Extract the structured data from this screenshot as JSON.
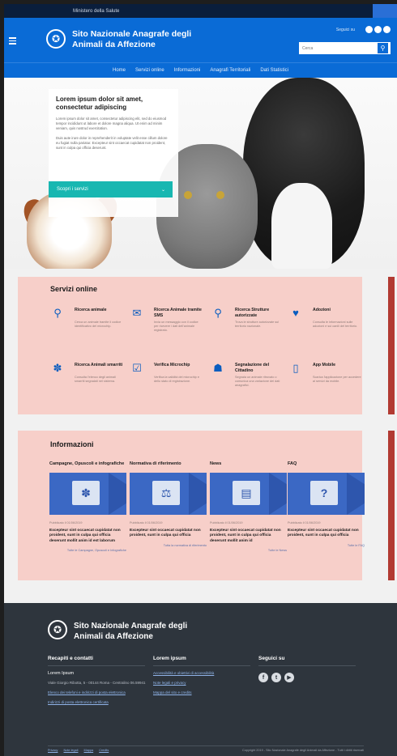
{
  "topbar": {
    "text": "Ministero della Salute"
  },
  "header": {
    "title_line1": "Sito Nazionale Anagrafe degli",
    "title_line2": "Animali da Affezione",
    "login": "Seguici su",
    "search_placeholder": "Cerca",
    "colors": {
      "primary": "#0a6bd6",
      "accent": "#18b7b1"
    }
  },
  "nav": {
    "items": [
      "Home",
      "Servizi online",
      "Informazioni",
      "Anagrafi Territoriali",
      "Dati Statistici"
    ]
  },
  "hero": {
    "title": "Lorem ipsum dolor sit amet, consectetur adipiscing",
    "para1": "Lorem ipsum dolor sit amet, consectetur adipiscing elit, sed do eiusmod tempor incididunt ut labore et dolore magna aliqua. Ut enim ad minim veniam, quis nostrud exercitation.",
    "para2": "Duis aute irure dolor in reprehenderit in voluptate velit esse cillum dolore eu fugiat nulla pariatur. Excepteur sint occaecat cupidatat non proident, sunt in culpa qui officia deserunt.",
    "cta": "Scopri i servizi"
  },
  "services": {
    "title": "Servizi online",
    "items": [
      {
        "icon": "search-icon",
        "glyph": "🔍",
        "title": "Ricerca animale",
        "desc": "Cerca un animale tramite il codice identificativo del microchip."
      },
      {
        "icon": "mail-icon",
        "glyph": "✉",
        "title": "Ricerca Animale tramite SMS",
        "desc": "Invia un messaggio con il codice per ricevere i dati dell'animale registrato."
      },
      {
        "icon": "location-icon",
        "glyph": "⚲",
        "title": "Ricerca Strutture autorizzate",
        "desc": "Trova le strutture autorizzate sul territorio nazionale."
      },
      {
        "icon": "heart-icon",
        "glyph": "♥",
        "title": "Adozioni",
        "desc": "Consulta le informazioni sulle adozioni e sui canili del territorio."
      },
      {
        "icon": "paw-icon",
        "glyph": "🐾",
        "title": "Ricerca Animali smarriti",
        "desc": "Consulta l'elenco degli animali smarriti segnalati nel sistema."
      },
      {
        "icon": "check-icon",
        "glyph": "☑",
        "title": "Verifica Microchip",
        "desc": "Verifica la validità del microchip e dello stato di registrazione."
      },
      {
        "icon": "user-icon",
        "glyph": "👤",
        "title": "Segnalazione del Cittadino",
        "desc": "Segnala un animale ritrovato o comunica una variazione dei dati anagrafici."
      },
      {
        "icon": "phone-icon",
        "glyph": "▯",
        "title": "App Mobile",
        "desc": "Scarica l'applicazione per accedere ai servizi da mobile."
      }
    ]
  },
  "info": {
    "title": "Informazioni",
    "cols": [
      {
        "cat": "Campagne, Opuscoli e infografiche",
        "glyph": "🐾",
        "date": "Pubblicato il 01/06/2019",
        "headline": "Excepteur sint occaecat cupidatat non proident, sunt in culpa qui officia deserunt mollit anim id est laborum",
        "more": "Tutte le Campagne, Opuscoli e Infografiche"
      },
      {
        "cat": "Normativa di riferimento",
        "glyph": "⚖",
        "date": "Pubblicato il 01/06/2019",
        "headline": "Excepteur sint occaecat cupidatat non proident, sunt in culpa qui officia",
        "more": "Tutta la normativa di riferimento"
      },
      {
        "cat": "News",
        "glyph": "▤",
        "date": "Pubblicato il 01/06/2019",
        "headline": "Excepteur sint occaecat cupidatat non proident, sunt in culpa qui officia deserunt mollit anim id",
        "more": "Tutte le News"
      },
      {
        "cat": "FAQ",
        "glyph": "?",
        "date": "Pubblicato il 01/06/2019",
        "headline": "Excepteur sint occaecat cupidatat non proident, sunt in culpa qui officia",
        "more": "Tutte le FAQ"
      }
    ]
  },
  "footer": {
    "title_line1": "Sito Nazionale Anagrafe degli",
    "title_line2": "Animali da Affezione",
    "col1": {
      "title": "Recapiti e contatti",
      "name": "Lorem Ipsum",
      "address": "Viale Giorgio Ribotta, 5 - 00144 Roma - Centralino 06.59941",
      "link1": "Elenco dei telefoni e indirizzi di posta elettronica",
      "link2": "Indirizzi di posta elettronica certificata"
    },
    "col2": {
      "title": "Lorem ipsum",
      "links": [
        "Accessibilità e obiettivi di accessibilità",
        "Note legali e privacy",
        "Mappa del sito e credits"
      ]
    },
    "col3": {
      "title": "Seguici su"
    },
    "bottom_links": [
      "Privacy",
      "Note legali",
      "Mappa",
      "Credits"
    ],
    "copyright": "Copyright 2019 - Sito Nazionale Anagrafe degli Animali da Affezione - Tutti i diritti riservati"
  }
}
